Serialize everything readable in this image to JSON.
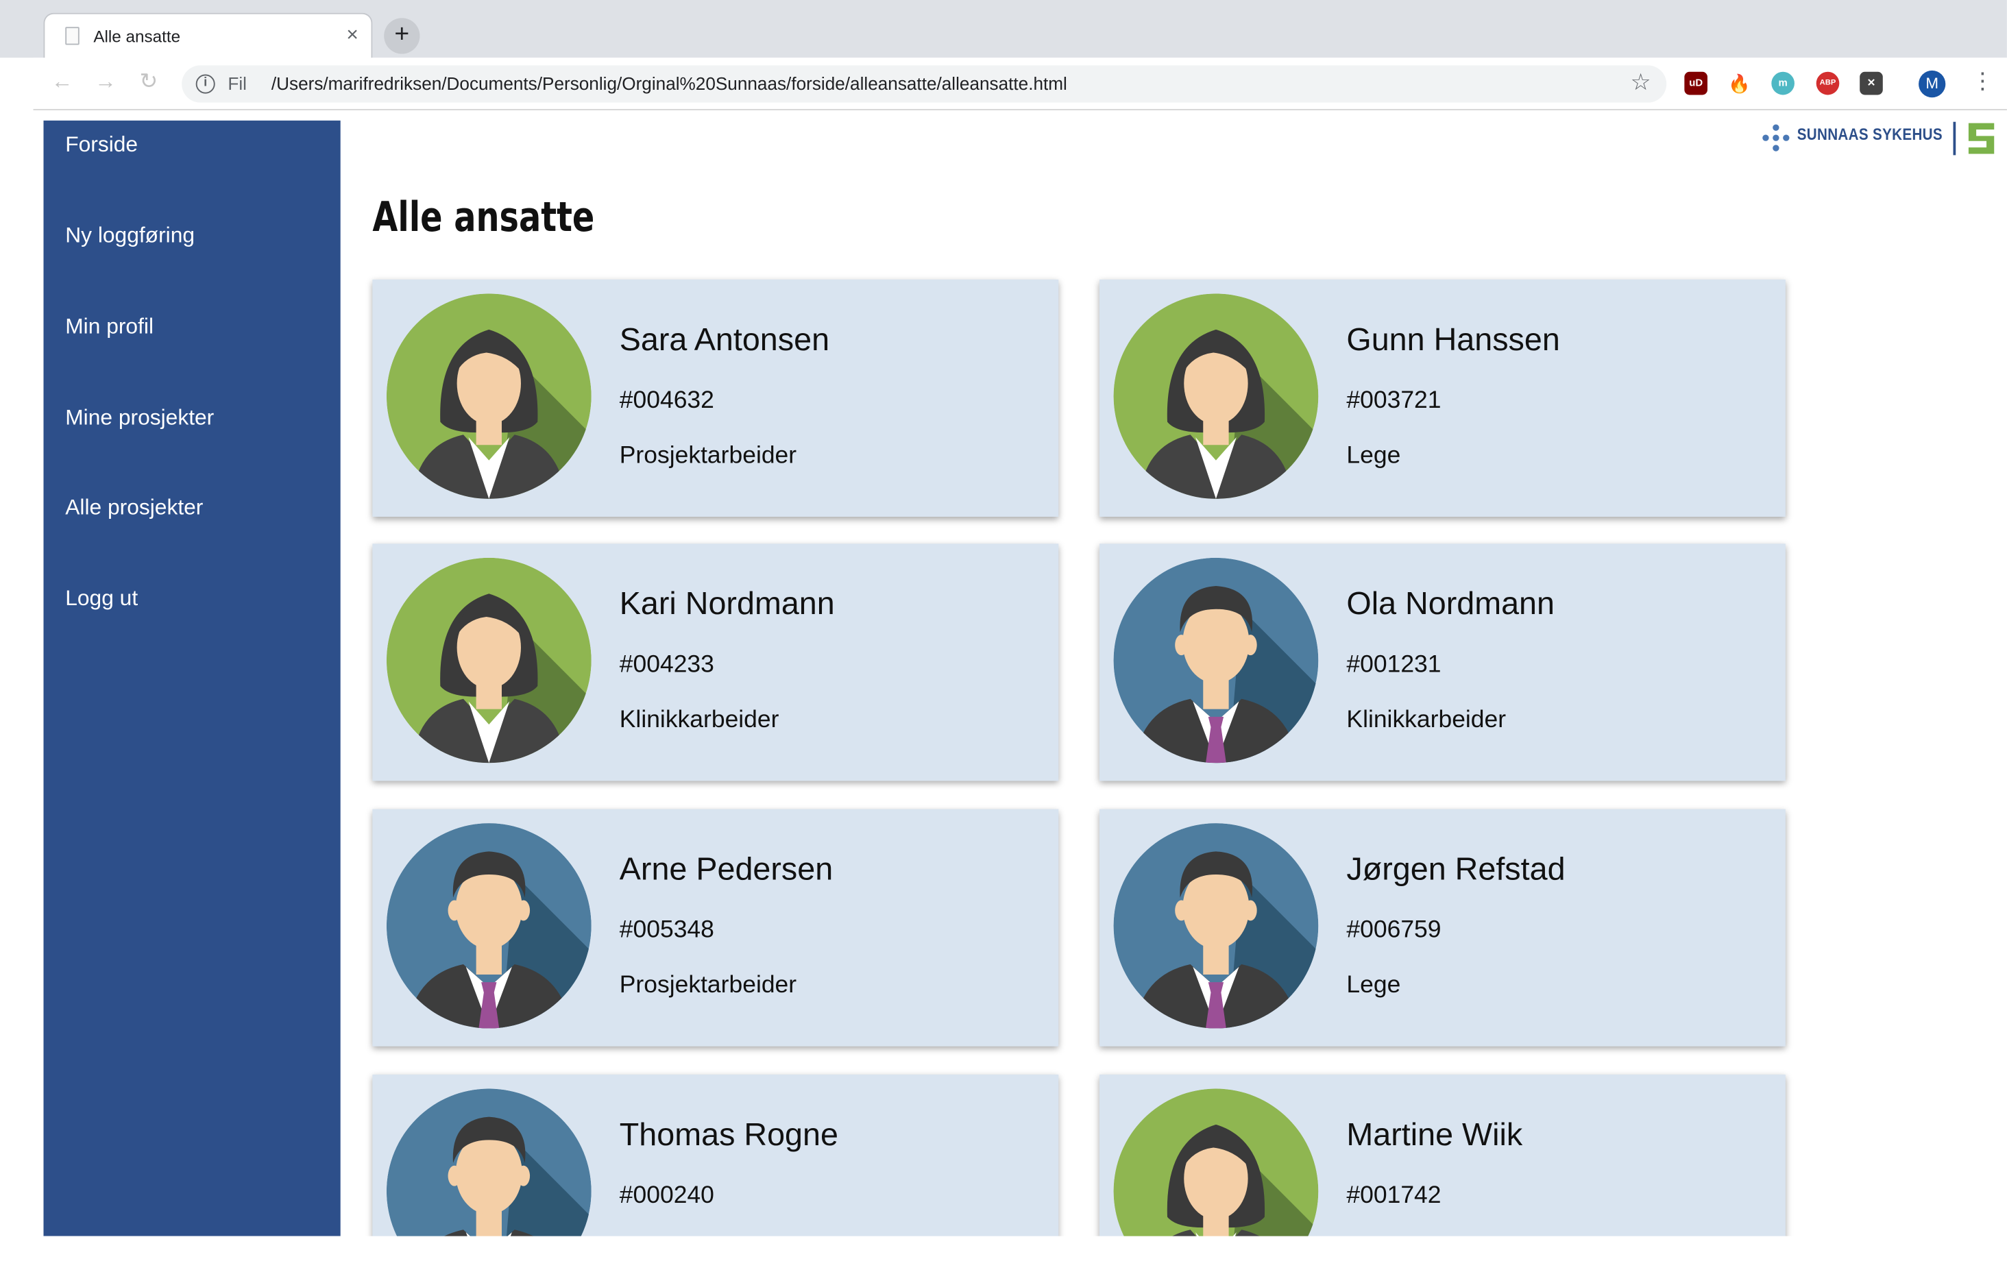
{
  "browser": {
    "tab_title": "Alle ansatte",
    "tab_close": "×",
    "new_tab": "+",
    "back": "←",
    "forward": "→",
    "reload": "↻",
    "info": "i",
    "scheme_label": "Fil",
    "url": "/Users/marifredriksen/Documents/Personlig/Orginal%20Sunnaas/forside/alleansatte/alleansatte.html",
    "bookmark": "☆",
    "extensions": [
      {
        "label": "uD",
        "color": "#800000"
      },
      {
        "label": "🔥",
        "color": "transparent"
      },
      {
        "label": "m",
        "color": "#4fb8c4"
      },
      {
        "label": "ABP",
        "color": "#d32f2f"
      },
      {
        "label": "✕",
        "color": "#444444"
      }
    ],
    "profile_initial": "M",
    "menu": "⋮"
  },
  "logo": {
    "text": "SUNNAAS SYKEHUS"
  },
  "sidebar": {
    "items": [
      {
        "label": "Forside"
      },
      {
        "label": "Ny loggføring"
      },
      {
        "label": "Min profil"
      },
      {
        "label": "Mine prosjekter"
      },
      {
        "label": "Alle prosjekter"
      },
      {
        "label": "Logg ut"
      }
    ]
  },
  "main": {
    "title": "Alle ansatte",
    "employees": [
      {
        "name": "Sara Antonsen",
        "id": "#004632",
        "role": "Prosjektarbeider",
        "avatar": "female-avatar"
      },
      {
        "name": "Gunn Hanssen",
        "id": "#003721",
        "role": "Lege",
        "avatar": "female-avatar"
      },
      {
        "name": "Kari Nordmann",
        "id": "#004233",
        "role": "Klinikkarbeider",
        "avatar": "female-avatar"
      },
      {
        "name": "Ola Nordmann",
        "id": "#001231",
        "role": "Klinikkarbeider",
        "avatar": "male-avatar"
      },
      {
        "name": "Arne Pedersen",
        "id": "#005348",
        "role": "Prosjektarbeider",
        "avatar": "male-avatar"
      },
      {
        "name": "Jørgen Refstad",
        "id": "#006759",
        "role": "Lege",
        "avatar": "male-avatar"
      },
      {
        "name": "Thomas Rogne",
        "id": "#000240",
        "role": "",
        "avatar": "male-avatar"
      },
      {
        "name": "Martine Wiik",
        "id": "#001742",
        "role": "",
        "avatar": "female-avatar"
      }
    ]
  },
  "colors": {
    "sidebar": "#2d4f8a",
    "card": "#d9e4f0",
    "female_avatar_bg": "#8fb651",
    "male_avatar_bg": "#4e7d9f"
  }
}
